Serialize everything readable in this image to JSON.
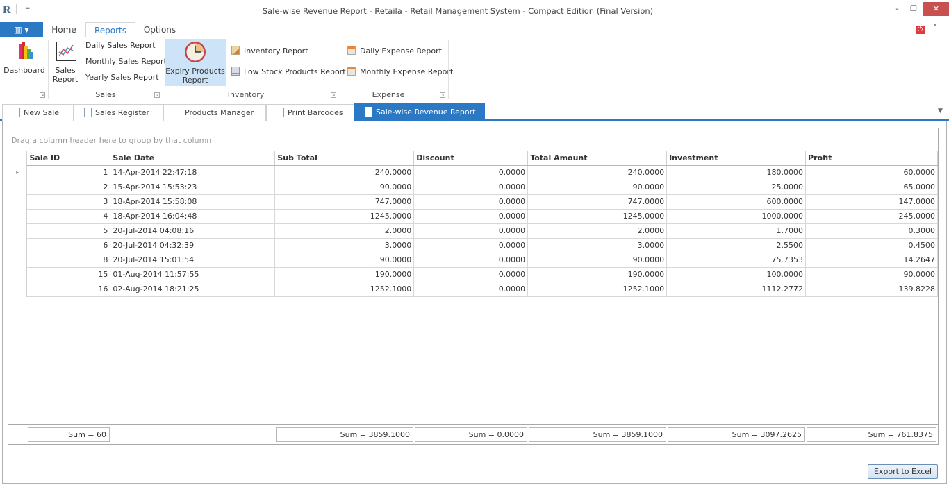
{
  "window": {
    "title": "Sale-wise Revenue Report - Retaila - Retail Management System - Compact Edition (Final Version)",
    "logo_letter": "R",
    "qat_dropdown": "═",
    "minimize": "–",
    "restore": "❐",
    "close": "✕"
  },
  "ribbon_tabs": {
    "app_menu_icon": "▥ ▾",
    "items": [
      {
        "label": "Home",
        "active": false
      },
      {
        "label": "Reports",
        "active": true
      },
      {
        "label": "Options",
        "active": false
      }
    ],
    "power_icon": "⏻",
    "collapse_icon": "˄"
  },
  "ribbon": {
    "groups": [
      {
        "name": "dashboard",
        "label": "",
        "buttons": [
          {
            "label": "Dashboard",
            "icon": "bar-chart-icon"
          }
        ]
      },
      {
        "name": "sales",
        "label": "Sales",
        "big_button": {
          "line1": "Sales",
          "line2": "Report",
          "icon": "line-chart-icon"
        },
        "small_buttons": [
          "Daily Sales Report",
          "Monthly Sales Report",
          "Yearly Sales Report"
        ]
      },
      {
        "name": "inventory",
        "label": "Inventory",
        "big_button": {
          "line1": "Expiry Products",
          "line2": "Report",
          "icon": "clock-icon"
        },
        "small_buttons": [
          "Inventory Report",
          "Low Stock Products Report"
        ]
      },
      {
        "name": "expense",
        "label": "Expense",
        "small_buttons": [
          "Daily Expense Report",
          "Monthly Expense Report"
        ]
      }
    ],
    "launcher_glyph": "↘"
  },
  "doc_tabs": {
    "items": [
      {
        "label": "New Sale",
        "active": false
      },
      {
        "label": "Sales Register",
        "active": false
      },
      {
        "label": "Products Manager",
        "active": false
      },
      {
        "label": "Print Barcodes",
        "active": false
      },
      {
        "label": "Sale-wise Revenue Report",
        "active": true
      }
    ],
    "close_glyph": "✕",
    "dropdown_glyph": "▼"
  },
  "grid": {
    "group_panel_text": "Drag a column header here to group by that column",
    "row_indicator": "▸",
    "columns": [
      "Sale ID",
      "Sale Date",
      "Sub Total",
      "Discount",
      "Total Amount",
      "Investment",
      "Profit"
    ],
    "rows": [
      [
        "1",
        "14-Apr-2014  22:47:18",
        "240.0000",
        "0.0000",
        "240.0000",
        "180.0000",
        "60.0000"
      ],
      [
        "2",
        "15-Apr-2014  15:53:23",
        "90.0000",
        "0.0000",
        "90.0000",
        "25.0000",
        "65.0000"
      ],
      [
        "3",
        "18-Apr-2014  15:58:08",
        "747.0000",
        "0.0000",
        "747.0000",
        "600.0000",
        "147.0000"
      ],
      [
        "4",
        "18-Apr-2014  16:04:48",
        "1245.0000",
        "0.0000",
        "1245.0000",
        "1000.0000",
        "245.0000"
      ],
      [
        "5",
        "20-Jul-2014  04:08:16",
        "2.0000",
        "0.0000",
        "2.0000",
        "1.7000",
        "0.3000"
      ],
      [
        "6",
        "20-Jul-2014  04:32:39",
        "3.0000",
        "0.0000",
        "3.0000",
        "2.5500",
        "0.4500"
      ],
      [
        "8",
        "20-Jul-2014  15:01:54",
        "90.0000",
        "0.0000",
        "90.0000",
        "75.7353",
        "14.2647"
      ],
      [
        "15",
        "01-Aug-2014  11:57:55",
        "190.0000",
        "0.0000",
        "190.0000",
        "100.0000",
        "90.0000"
      ],
      [
        "16",
        "02-Aug-2014  18:21:25",
        "1252.1000",
        "0.0000",
        "1252.1000",
        "1112.2772",
        "139.8228"
      ]
    ],
    "summary": {
      "sale_id": "Sum = 60",
      "sub_total": "Sum = 3859.1000",
      "discount": "Sum = 0.0000",
      "total_amount": "Sum = 3859.1000",
      "investment": "Sum = 3097.2625",
      "profit": "Sum = 761.8375"
    }
  },
  "actions": {
    "export_label": "Export to Excel"
  },
  "colors": {
    "accent": "#2b79c5",
    "close_button": "#c75050",
    "selected_ribbon_button": "#cde3f7",
    "power_icon": "#e03a3a"
  }
}
